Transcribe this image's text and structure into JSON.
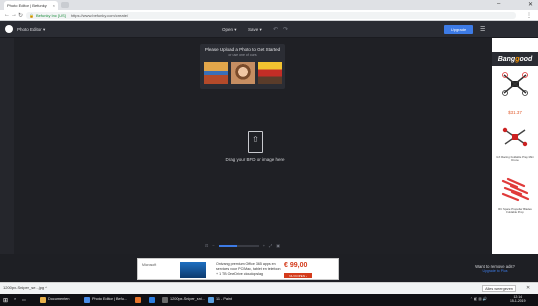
{
  "browser": {
    "tab_title": "Photo Editor | Befunky",
    "tab_close": "×",
    "url_secure": "Befunky Inc [US]",
    "url": "https://www.befunky.com/create/",
    "win_min": "–",
    "win_close": "✕"
  },
  "header": {
    "app_name": "Photo Editor ▾",
    "open_label": "Open ▾",
    "save_label": "Save ▾",
    "undo_glyph": "↶",
    "redo_glyph": "↷",
    "upgrade_label": "Upgrade"
  },
  "samples": {
    "title": "Please Upload a Photo to Get Started",
    "subtitle": "or use one of ours"
  },
  "dropzone": {
    "text": "Drag your BFD or image here"
  },
  "zoom": {
    "minus": "−",
    "plus": "+",
    "level": 0.45
  },
  "ads_right": {
    "brand_pre": "Bang",
    "brand_accent": "g",
    "brand_post": "ood",
    "price": "$31.37",
    "caption2": "GX Racing Foldable Pray Mini Drone",
    "caption3": "RC Spare Propeller Blades Foldable Prop"
  },
  "ad_bottom": {
    "brand": "Microsoft",
    "line1": "Ontvang premium Office 365 apps en",
    "line2": "services voor PC/Mac, tablet en telefoon",
    "line3": "+ 1 TB OneDrive cloudopslag",
    "price": "€ 99,00",
    "cta": "NU KOPEN ›",
    "remove_title": "Want to remove ads?",
    "remove_link": "Upgrade to Plus"
  },
  "downloads": {
    "item": "1200px-Sniper_se...jpg ^",
    "show_all": "Alles weergeven",
    "close": "✕"
  },
  "taskbar": {
    "start": "⊞",
    "items": [
      "Documenten",
      "Photo Editor | Befu...",
      "1200px-Sniper_sni...",
      "11 - Paint"
    ],
    "clock_time": "12:14",
    "clock_date": "15-1-2019"
  },
  "colors": {
    "accent": "#3d7be6",
    "workspace": "#1f2025",
    "header": "#2a2c33"
  }
}
